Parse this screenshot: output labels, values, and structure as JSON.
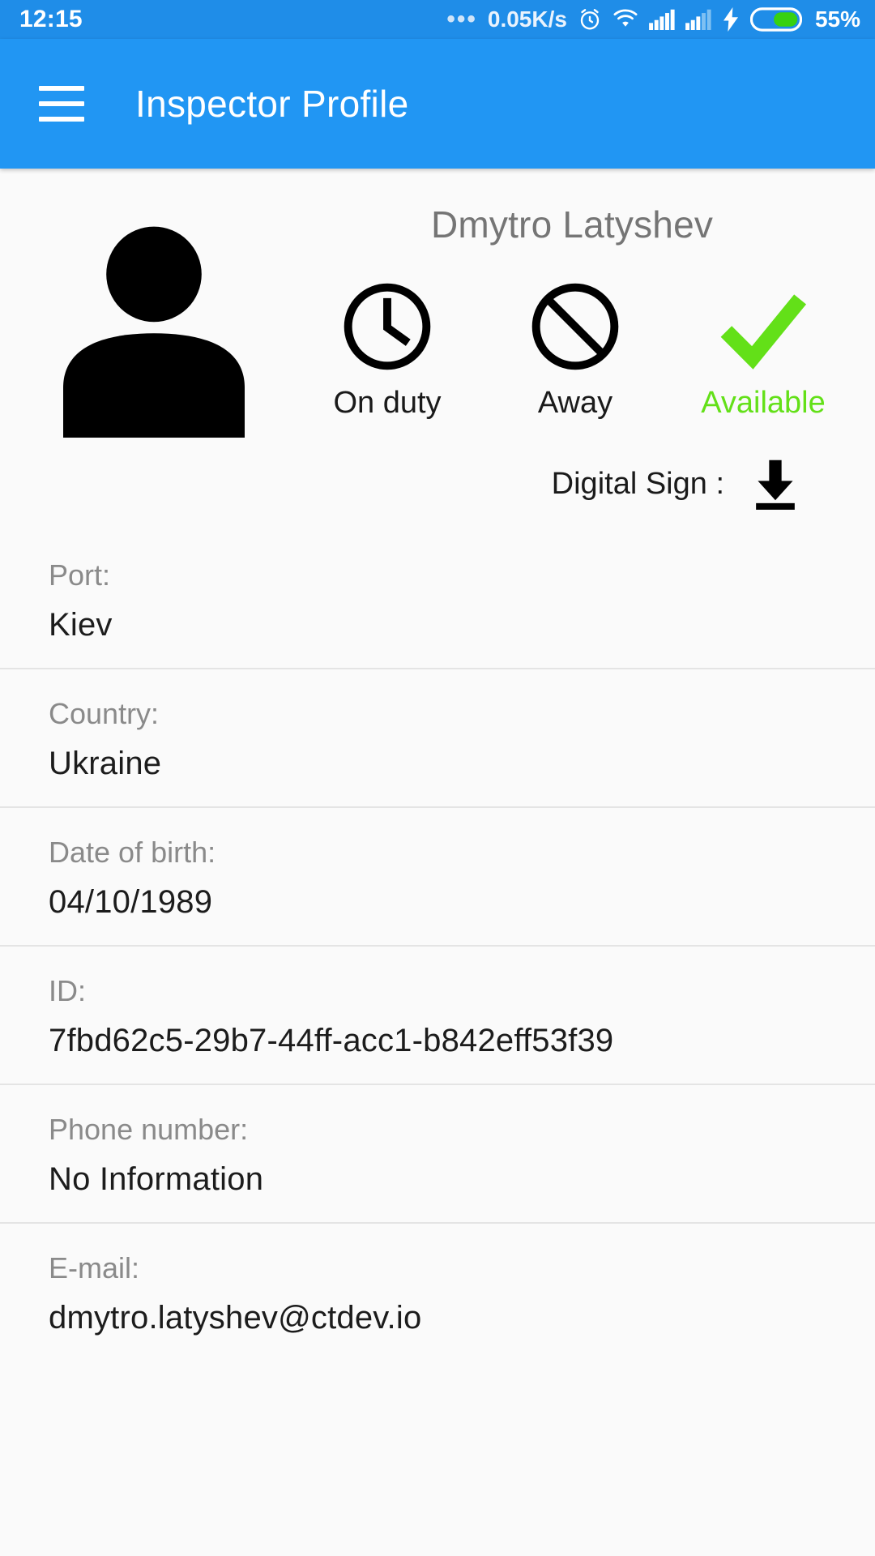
{
  "statusbar": {
    "time": "12:15",
    "overflow_dots": "•••",
    "network_speed": "0.05K/s",
    "battery_percent": "55%",
    "icons": [
      "alarm-icon",
      "wifi-icon",
      "signal-sim1-icon",
      "signal-sim2-icon",
      "charging-bolt-icon",
      "battery-icon"
    ]
  },
  "appbar": {
    "menu_icon": "hamburger-menu-icon",
    "title": "Inspector Profile",
    "background_color": "#2196f3"
  },
  "profile": {
    "avatar_icon": "person-avatar-icon",
    "name": "Dmytro Latyshev",
    "statuses": [
      {
        "id": "on-duty",
        "label": "On duty",
        "icon": "clock-icon",
        "active": false,
        "color": "#000000"
      },
      {
        "id": "away",
        "label": "Away",
        "icon": "no-entry-icon",
        "active": false,
        "color": "#000000"
      },
      {
        "id": "available",
        "label": "Available",
        "icon": "checkmark-icon",
        "active": true,
        "color": "#63e018"
      }
    ],
    "digital_sign": {
      "label": "Digital Sign :",
      "icon": "download-icon"
    }
  },
  "details": [
    {
      "label": "Port:",
      "value": "Kiev"
    },
    {
      "label": "Country:",
      "value": "Ukraine"
    },
    {
      "label": "Date of birth:",
      "value": "04/10/1989"
    },
    {
      "label": "ID:",
      "value": "7fbd62c5-29b7-44ff-acc1-b842eff53f39"
    },
    {
      "label": "Phone number:",
      "value": "No Information"
    },
    {
      "label": "E-mail:",
      "value": "dmytro.latyshev@ctdev.io"
    }
  ],
  "colors": {
    "accent": "#2196f3",
    "status_bar": "#1f8de8",
    "available_green": "#63e018",
    "page_background": "#fafafa",
    "divider": "#e4e4e4"
  }
}
